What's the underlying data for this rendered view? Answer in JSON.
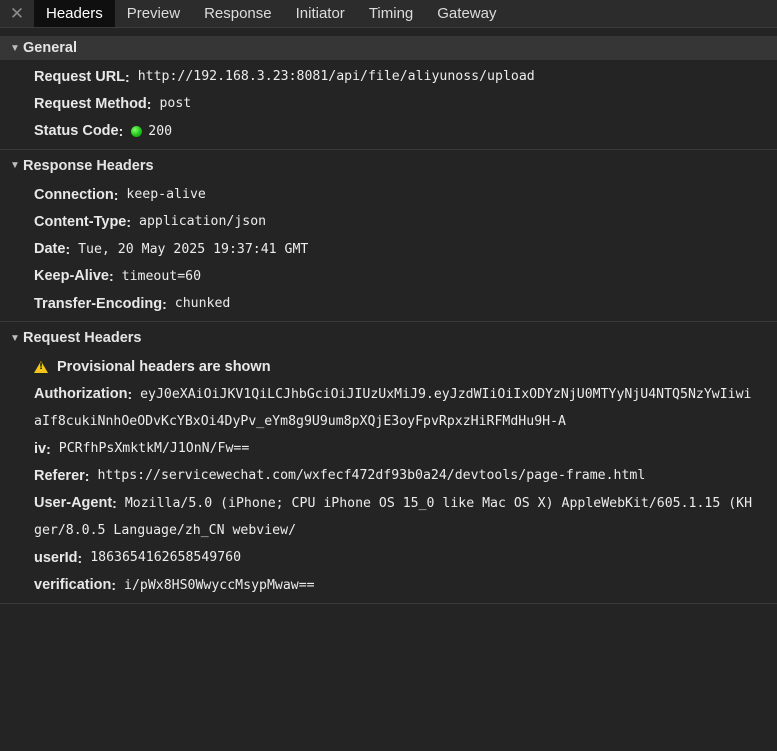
{
  "tabs": {
    "close_glyph": "✕",
    "items": [
      {
        "label": "Headers",
        "active": true
      },
      {
        "label": "Preview",
        "active": false
      },
      {
        "label": "Response",
        "active": false
      },
      {
        "label": "Initiator",
        "active": false
      },
      {
        "label": "Timing",
        "active": false
      },
      {
        "label": "Gateway",
        "active": false
      }
    ]
  },
  "general": {
    "title": "General",
    "request_url": {
      "key": "Request URL",
      "value": "http://192.168.3.23:8081/api/file/aliyunoss/upload"
    },
    "request_method": {
      "key": "Request Method",
      "value": "post"
    },
    "status_code": {
      "key": "Status Code",
      "value": "200",
      "status_color": "#22c31a"
    }
  },
  "response_headers": {
    "title": "Response Headers",
    "items": [
      {
        "key": "Connection",
        "value": "keep-alive"
      },
      {
        "key": "Content-Type",
        "value": "application/json"
      },
      {
        "key": "Date",
        "value": "Tue, 20 May 2025 19:37:41 GMT"
      },
      {
        "key": "Keep-Alive",
        "value": "timeout=60"
      },
      {
        "key": "Transfer-Encoding",
        "value": "chunked"
      }
    ]
  },
  "request_headers": {
    "title": "Request Headers",
    "warning": "Provisional headers are shown",
    "authorization": {
      "key": "Authorization",
      "value": "eyJ0eXAiOiJKV1QiLCJhbGciOiJIUzUxMiJ9.eyJzdWIiOiIxODYzNjU0MTYyNjU4NTQ5NzYwIiwi",
      "value_cont": "aIf8cukiNnhOeODvKcYBxOi4DyPv_eYm8g9U9um8pXQjE3oyFpvRpxzHiRFMdHu9H-A"
    },
    "iv": {
      "key": "iv",
      "value": "PCRfhPsXmktkM/J1OnN/Fw=="
    },
    "referer": {
      "key": "Referer",
      "value": "https://servicewechat.com/wxfecf472df93b0a24/devtools/page-frame.html"
    },
    "user_agent": {
      "key": "User-Agent",
      "value": "Mozilla/5.0 (iPhone; CPU iPhone OS 15_0 like Mac OS X) AppleWebKit/605.1.15 (KH",
      "value_cont": "ger/8.0.5 Language/zh_CN webview/"
    },
    "userid": {
      "key": "userId",
      "value": "1863654162658549760"
    },
    "verification": {
      "key": "verification",
      "value": "i/pWx8HS0WwyccMsypMwaw=="
    }
  }
}
